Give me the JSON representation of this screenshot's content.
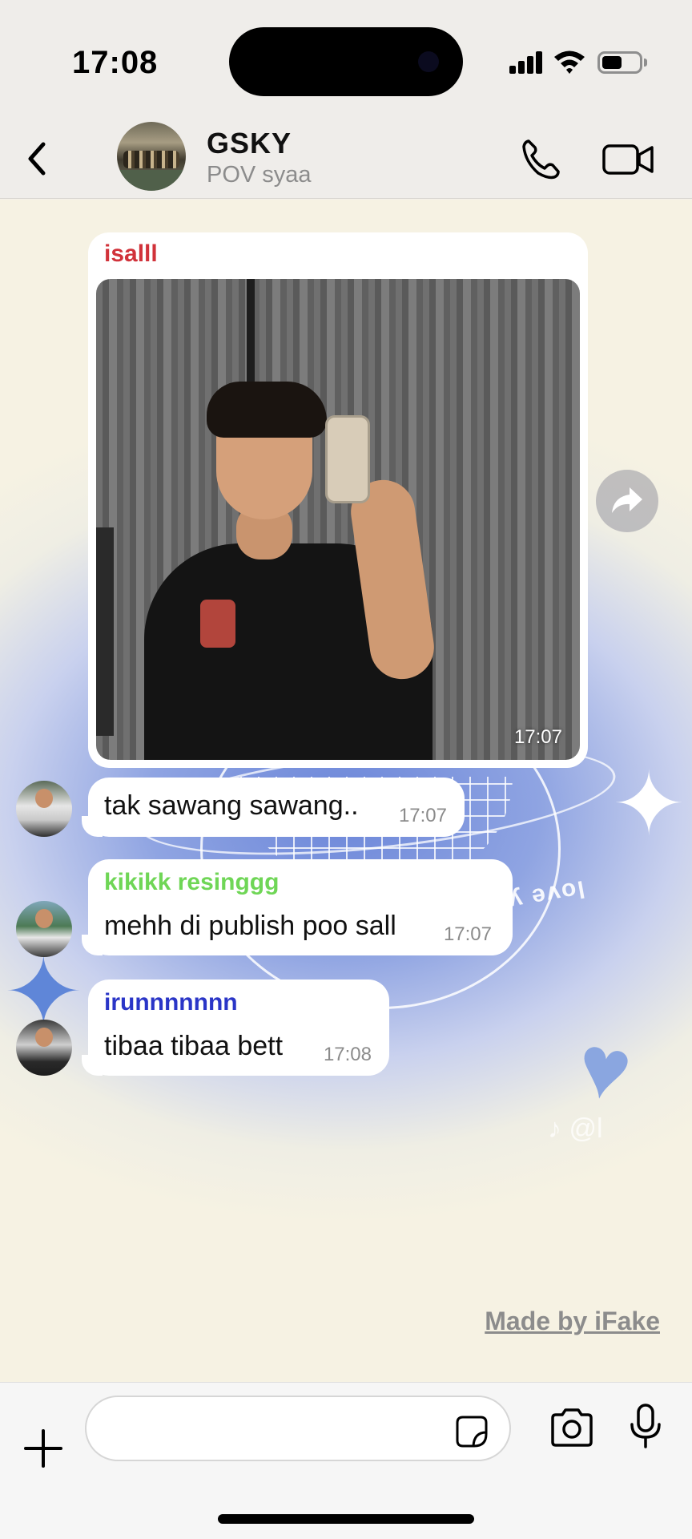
{
  "status_bar": {
    "time": "17:08",
    "battery_level": 0.55
  },
  "header": {
    "chat_name": "GSKY",
    "subtitle": "POV syaa",
    "icons": [
      "back-chevron-icon",
      "phone-icon",
      "video-camera-icon"
    ]
  },
  "messages": [
    {
      "sender": "isalll",
      "sender_color": "#d1323a",
      "type": "image",
      "time": "17:07"
    },
    {
      "sender": "",
      "type": "text",
      "text": "tak sawang sawang..",
      "time": "17:07"
    },
    {
      "sender": "kikikk resinggg",
      "sender_color": "#6fd656",
      "type": "text",
      "text": "mehh di publish poo sall",
      "time": "17:07"
    },
    {
      "sender": "irunnnnnnn",
      "sender_color": "#2a35c7",
      "type": "text",
      "text": "tibaa tibaa bett",
      "time": "17:08"
    }
  ],
  "background": {
    "love_text": "love yourself",
    "watermark": "♪ @l"
  },
  "footer_credit": "Made by iFake",
  "composer": {
    "value": "",
    "placeholder": ""
  }
}
